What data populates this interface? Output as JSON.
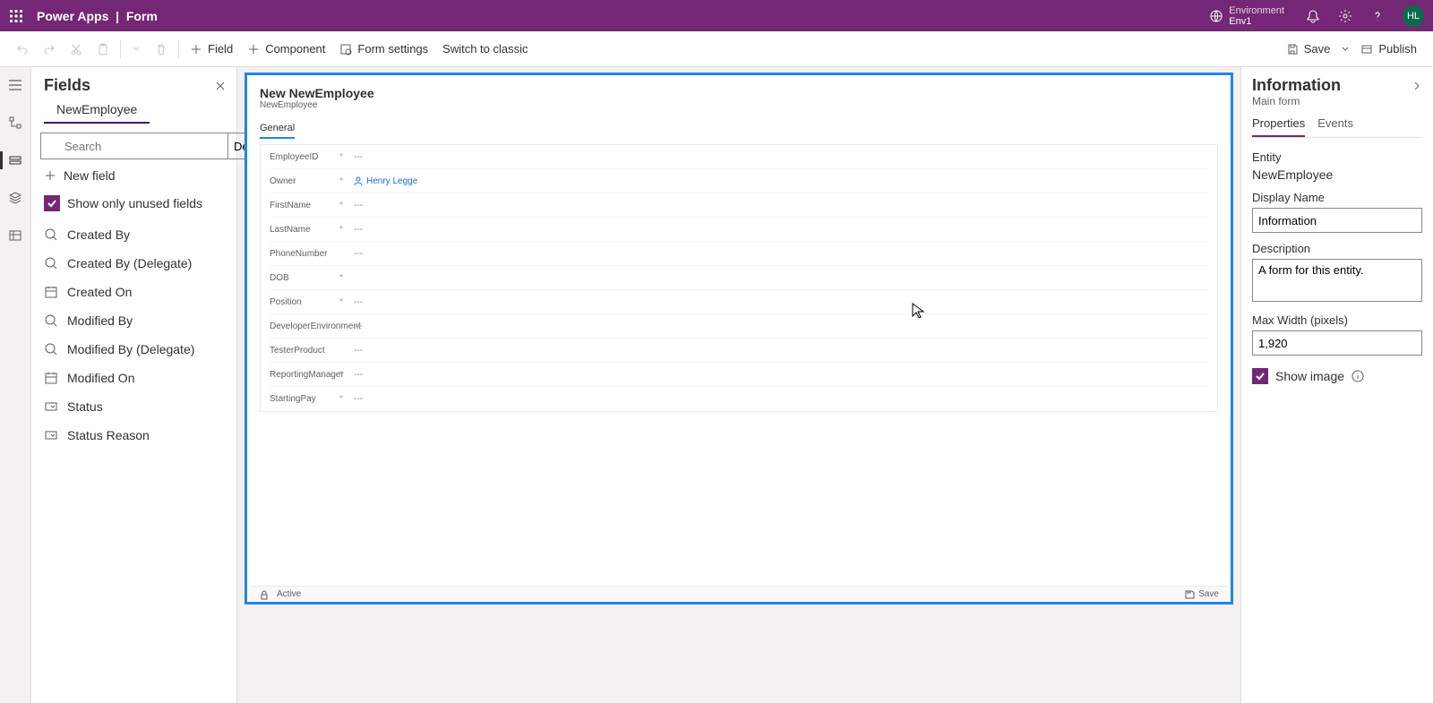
{
  "header": {
    "app_name": "Power Apps",
    "page": "Form",
    "env_label": "Environment",
    "env_name": "Env1",
    "avatar": "HL"
  },
  "cmdbar": {
    "field": "Field",
    "component": "Component",
    "form_settings": "Form settings",
    "switch_classic": "Switch to classic",
    "save": "Save",
    "publish": "Publish"
  },
  "fields_panel": {
    "title": "Fields",
    "entity": "NewEmployee",
    "search_placeholder": "Search",
    "default_label": "Default",
    "new_field": "New field",
    "show_unused": "Show only unused fields",
    "items": [
      {
        "icon": "lookup",
        "label": "Created By"
      },
      {
        "icon": "lookup",
        "label": "Created By (Delegate)"
      },
      {
        "icon": "date",
        "label": "Created On"
      },
      {
        "icon": "lookup",
        "label": "Modified By"
      },
      {
        "icon": "lookup",
        "label": "Modified By (Delegate)"
      },
      {
        "icon": "date",
        "label": "Modified On"
      },
      {
        "icon": "choice",
        "label": "Status"
      },
      {
        "icon": "choice",
        "label": "Status Reason"
      }
    ]
  },
  "canvas": {
    "title": "New NewEmployee",
    "subtitle": "NewEmployee",
    "tab": "General",
    "owner_name": "Henry Legge",
    "rows": [
      {
        "label": "EmployeeID",
        "required": true,
        "value": "---"
      },
      {
        "label": "Owner",
        "required": true,
        "value": "__OWNER__"
      },
      {
        "label": "FirstName",
        "required": true,
        "value": "---"
      },
      {
        "label": "LastName",
        "required": true,
        "value": "---"
      },
      {
        "label": "PhoneNumber",
        "required": false,
        "value": "---"
      },
      {
        "label": "DOB",
        "required": true,
        "value": ""
      },
      {
        "label": "Position",
        "required": true,
        "value": "---"
      },
      {
        "label": "DeveloperEnvironment",
        "required": false,
        "value": "---"
      },
      {
        "label": "TesterProduct",
        "required": false,
        "value": "---"
      },
      {
        "label": "ReportingManager",
        "required": true,
        "value": "---"
      },
      {
        "label": "StartingPay",
        "required": true,
        "value": "---"
      }
    ],
    "footer_status": "Active",
    "footer_save": "Save"
  },
  "props": {
    "title": "Information",
    "subtitle": "Main form",
    "tab_properties": "Properties",
    "tab_events": "Events",
    "entity_label": "Entity",
    "entity_value": "NewEmployee",
    "displayname_label": "Display Name",
    "displayname_value": "Information",
    "description_label": "Description",
    "description_value": "A form for this entity.",
    "maxwidth_label": "Max Width (pixels)",
    "maxwidth_value": "1,920",
    "showimage_label": "Show image"
  }
}
